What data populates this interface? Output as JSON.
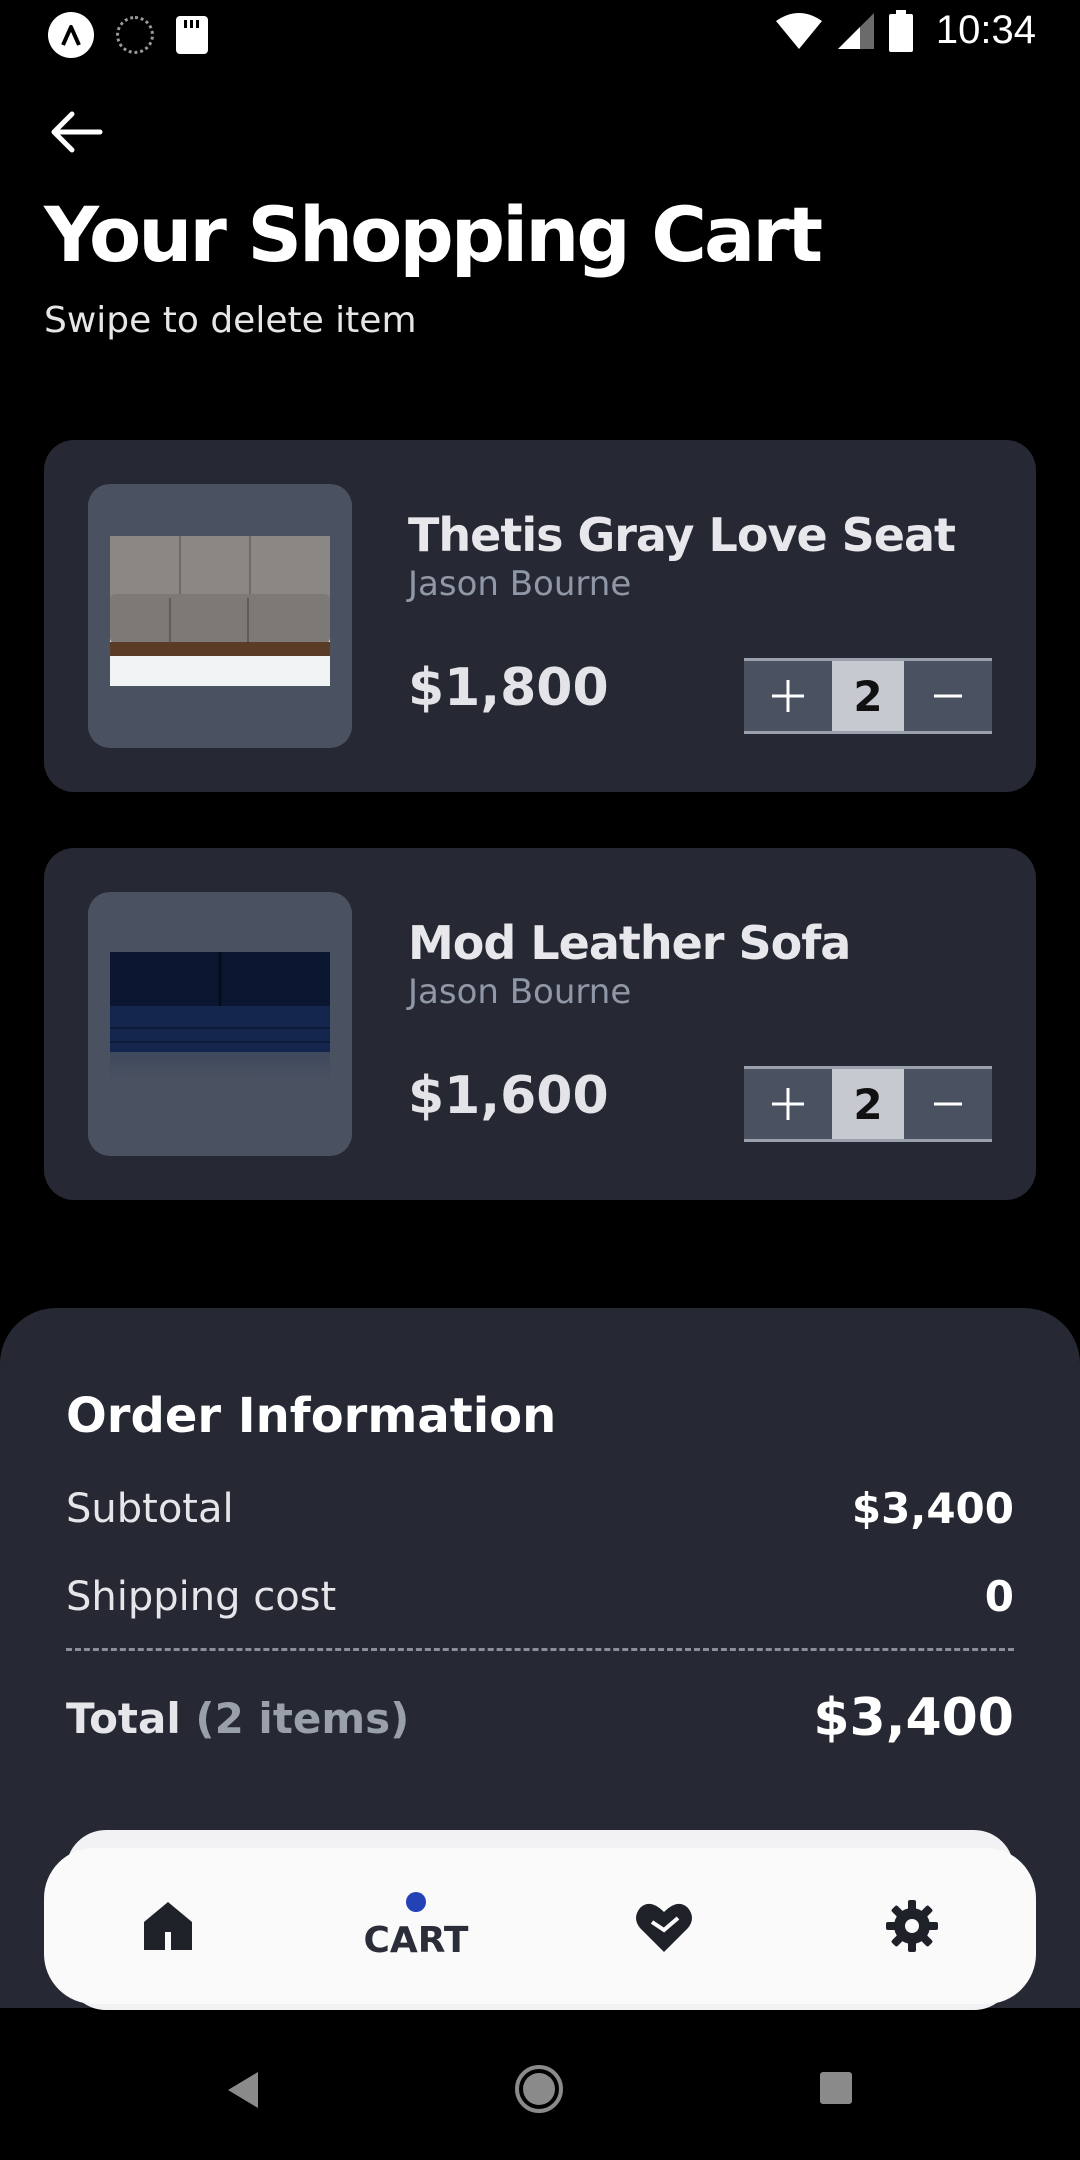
{
  "status_bar": {
    "time": "10:34",
    "icons": [
      "app-logo-icon",
      "loading-icon",
      "sd-card-icon",
      "wifi-icon",
      "signal-icon",
      "battery-icon"
    ]
  },
  "header": {
    "back_icon": "arrow-left-icon",
    "title": "Your Shopping Cart",
    "subtitle": "Swipe to delete item"
  },
  "cart": {
    "items": [
      {
        "name": "Thetis Gray Love Seat",
        "seller": "Jason Bourne",
        "price": "$1,800",
        "quantity": "2",
        "image": "gray-sofa-image"
      },
      {
        "name": "Mod Leather Sofa",
        "seller": "Jason Bourne",
        "price": "$1,600",
        "quantity": "2",
        "image": "navy-sofa-image"
      }
    ],
    "increment_symbol": "+",
    "decrement_symbol": "−"
  },
  "order": {
    "title": "Order Information",
    "subtotal_label": "Subtotal",
    "subtotal_value": "$3,400",
    "shipping_label": "Shipping cost",
    "shipping_value": "0",
    "total_label": "Total",
    "total_count": "(2 items)",
    "total_value": "$3,400"
  },
  "bottom_nav": {
    "items": [
      {
        "icon": "home-icon",
        "label": ""
      },
      {
        "icon": "",
        "label": "CART",
        "active": true
      },
      {
        "icon": "heart-icon",
        "label": ""
      },
      {
        "icon": "gear-icon",
        "label": ""
      }
    ],
    "active_color": "#2342b5"
  },
  "colors": {
    "background": "#000000",
    "card": "#262933",
    "thumb": "#4a5261",
    "qty_bg": "#c6c9cf"
  }
}
